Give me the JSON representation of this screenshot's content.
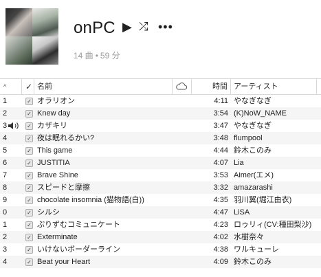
{
  "playlist": {
    "title": "onPC",
    "song_count": "14 曲",
    "duration": "59 分"
  },
  "icons": {
    "play": "play-icon",
    "shuffle": "shuffle-icon",
    "more": "more-icon",
    "speaker": "speaker-icon",
    "cloud": "cloud-icon",
    "check": "check-icon"
  },
  "columns": {
    "sort": "^",
    "check": "✓",
    "name": "名前",
    "time": "時間",
    "artist": "アーティスト"
  },
  "tracks": [
    {
      "num": "1",
      "name": "オラリオン",
      "time": "4:11",
      "artist": "やなぎなぎ"
    },
    {
      "num": "2",
      "name": "Knew day",
      "time": "3:54",
      "artist": "(K)NoW_NAME"
    },
    {
      "num": "3",
      "name": "カザキリ",
      "time": "3:47",
      "artist": "やなぎなぎ",
      "playing": true
    },
    {
      "num": "4",
      "name": "夜は眠れるかい?",
      "time": "3:48",
      "artist": "flumpool"
    },
    {
      "num": "5",
      "name": "This game",
      "time": "4:44",
      "artist": "鈴木このみ"
    },
    {
      "num": "6",
      "name": "JUSTITIA",
      "time": "4:07",
      "artist": "Lia"
    },
    {
      "num": "7",
      "name": "Brave Shine",
      "time": "3:53",
      "artist": "Aimer(エメ)"
    },
    {
      "num": "8",
      "name": "スピードと摩擦",
      "time": "3:32",
      "artist": "amazarashi"
    },
    {
      "num": "9",
      "name": "chocolate insomnia (猫物語(白))",
      "time": "4:35",
      "artist": "羽川翼(堀江由衣)"
    },
    {
      "num": "0",
      "name": "シルシ",
      "time": "4:47",
      "artist": "LiSA"
    },
    {
      "num": "1",
      "name": "ぷりずむコミュニケート",
      "time": "4:23",
      "artist": "ロゥリィ(CV:種田梨沙)"
    },
    {
      "num": "2",
      "name": "Exterminate",
      "time": "4:02",
      "artist": "水樹奈々"
    },
    {
      "num": "3",
      "name": "いけないボーダーライン",
      "time": "4:38",
      "artist": "ワルキューレ"
    },
    {
      "num": "4",
      "name": "Beat your Heart",
      "time": "4:09",
      "artist": "鈴木このみ"
    }
  ]
}
